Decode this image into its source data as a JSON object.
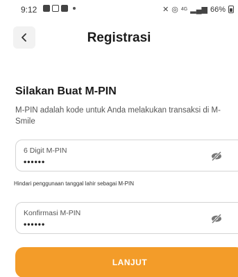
{
  "status_bar": {
    "time": "9:12",
    "battery": "66%",
    "network": "4G"
  },
  "header": {
    "title": "Registrasi",
    "back_icon": "chevron-left-icon"
  },
  "form": {
    "heading": "Silakan Buat M-PIN",
    "description": "M-PIN adalah kode untuk Anda melakukan transaksi di M-Smile",
    "pin_field": {
      "label": "6 Digit M-PIN",
      "value": "••••••",
      "toggle_icon": "eye-slash-icon"
    },
    "hint": "Hindari penggunaan tanggal lahir sebagai M-PIN",
    "confirm_field": {
      "label": "Konfirmasi M-PIN",
      "value": "••••••",
      "toggle_icon": "eye-slash-icon"
    },
    "submit_label": "LANJUT"
  },
  "colors": {
    "accent": "#f39c29",
    "background": "#ffffff"
  }
}
